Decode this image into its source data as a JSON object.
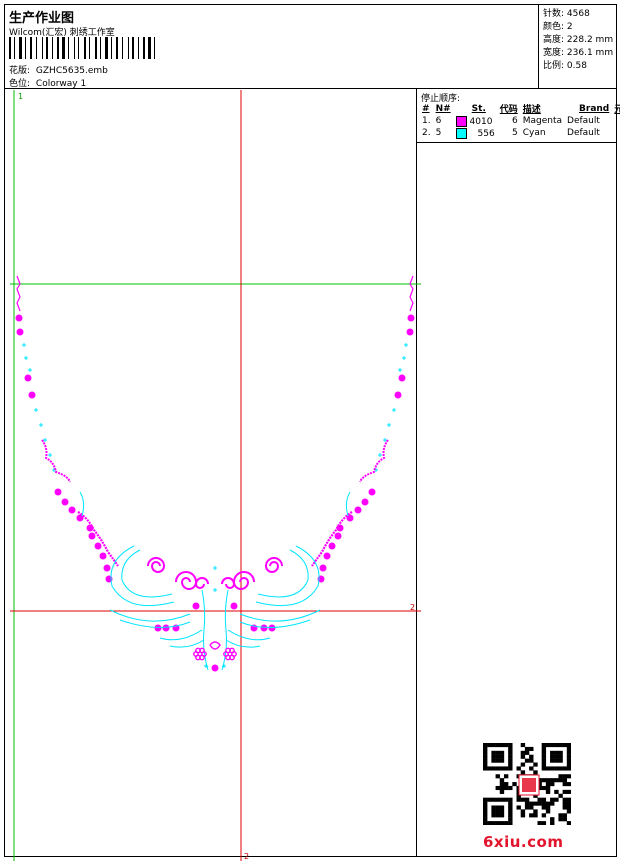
{
  "header": {
    "title": "生产作业图",
    "company": "Wilcom(汇宏) 刺绣工作室",
    "pattern_label": "花版:",
    "pattern_value": "GZHC5635.emb",
    "colorway_label": "色位:",
    "colorway_value": "Colorway 1"
  },
  "stats": [
    {
      "label": "针数:",
      "value": "4568"
    },
    {
      "label": "颜色:",
      "value": "2"
    },
    {
      "label": "高度:",
      "value": "228.2 mm"
    },
    {
      "label": "宽度:",
      "value": "236.1 mm"
    },
    {
      "label": "比例:",
      "value": "0.58"
    }
  ],
  "stop_sequence": {
    "title": "停止顺序:",
    "columns": [
      "#",
      "N#",
      "St.",
      "代码",
      "描述",
      "Brand",
      "元素"
    ],
    "rows": [
      {
        "idx": "1.",
        "n": "6",
        "color": "#ff00ff",
        "code": "4010",
        "stops": "6",
        "desc": "Magenta",
        "brand": "Default",
        "element": ""
      },
      {
        "idx": "2.",
        "n": "5",
        "color": "#00ffff",
        "code": "556",
        "stops": "5",
        "desc": "Cyan",
        "brand": "Default",
        "element": ""
      }
    ]
  },
  "guides": {
    "label_top_left": "1",
    "label_right": "2",
    "label_bottom": "2"
  },
  "colors": {
    "magenta": "#ff00ff",
    "cyan": "#00e5ff",
    "guide_red": "#e00000",
    "guide_green": "#00c000"
  },
  "watermark": {
    "text": "6xiu.com"
  }
}
